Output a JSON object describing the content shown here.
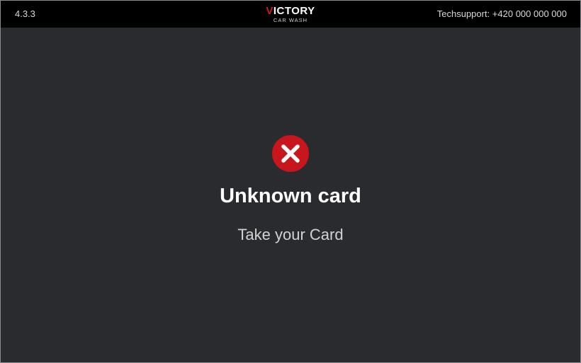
{
  "header": {
    "version": "4.3.3",
    "logo": {
      "mark": "V",
      "name_rest": "ICTORY",
      "subtitle": "CAR WASH"
    },
    "techsupport": "Techsupport: +420 000 000 000"
  },
  "message": {
    "icon": "error-x-icon",
    "title": "Unknown card",
    "subtitle": "Take your Card"
  },
  "colors": {
    "background": "#2a2b2f",
    "topbar": "#000000",
    "error_red": "#c8161d",
    "brand_red": "#d1171c"
  }
}
